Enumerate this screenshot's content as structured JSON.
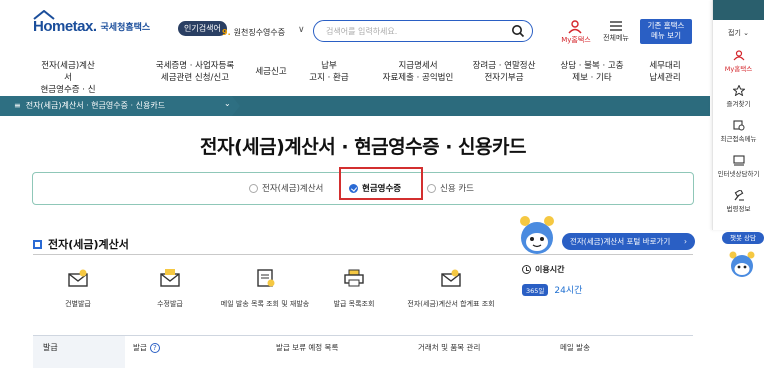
{
  "header": {
    "logo_text": "Hometax.",
    "logo_sub": "국세청홈택스",
    "popular_label": "인기검색어",
    "popular_rank": "9.",
    "popular_term": "원천징수영수증",
    "search_placeholder": "검색어를 입력하세요.",
    "my_label": "My홈택스",
    "all_menu_label": "전체메뉴",
    "prev_hometax_line1": "기존 홈택스",
    "prev_hometax_line2": "메뉴 보기"
  },
  "nav": [
    {
      "l1": "전자(세금)계산서",
      "l2": "현금영수증 · 신용카드"
    },
    {
      "l1": "국세증명 · 사업자등록",
      "l2": "세금관련 신청/신고"
    },
    {
      "l1": "세금신고",
      "l2": ""
    },
    {
      "l1": "납부",
      "l2": "고지 · 환급"
    },
    {
      "l1": "지급명세서",
      "l2": "자료제출 · 공익법인"
    },
    {
      "l1": "장려금 · 연말정산",
      "l2": "전자기부금"
    },
    {
      "l1": "상담 · 불복 · 고충",
      "l2": "제보 · 기타"
    },
    {
      "l1": "세무대리",
      "l2": "납세관리"
    }
  ],
  "breadcrumb": {
    "text": "전자(세금)계산서 · 현금영수증 · 신용카드"
  },
  "page_title": "전자(세금)계산서 · 현금영수증 · 신용카드",
  "tabs": [
    {
      "label": "전자(세금)계산서",
      "active": false
    },
    {
      "label": "현금영수증",
      "active": true
    },
    {
      "label": "신용 카드",
      "active": false
    }
  ],
  "section": {
    "title": "전자(세금)계산서",
    "portal_button": "전자(세금)계산서 포털 바로가기",
    "icons": [
      {
        "label": "건별발급",
        "icon": "envelope-pen-icon"
      },
      {
        "label": "수정발급",
        "icon": "envelope-edit-icon"
      },
      {
        "label": "메일 발송 목록 조회 및 재발송",
        "icon": "document-mail-icon"
      },
      {
        "label": "발급 목록조회",
        "icon": "printer-icon"
      },
      {
        "label": "전자(세금)계산서 합계표 조회",
        "icon": "envelope-search-icon"
      }
    ],
    "hours_title": "이용시간",
    "hours_badge": "365일",
    "hours_value": "24시간"
  },
  "table_row": {
    "header": "발급",
    "cells": [
      "발급",
      "발급 보류 예정 목록",
      "거래처 및 품목 관리",
      "메일 발송"
    ]
  },
  "rail": {
    "fold": "접기",
    "items": [
      {
        "label": "My홈택스",
        "icon": "person-icon"
      },
      {
        "label": "즐겨찾기",
        "icon": "star-icon"
      },
      {
        "label": "최근접속메뉴",
        "icon": "recent-icon"
      },
      {
        "label": "인터넷상담하기",
        "icon": "chat-icon"
      },
      {
        "label": "법령정보",
        "icon": "gavel-icon"
      }
    ],
    "chatbot": "챗봇 상담"
  },
  "colors": {
    "primary": "#2a5fc4",
    "breadcrumb": "#2c6b7d",
    "highlight": "#d32f2f",
    "brand": "#1b4e9b"
  }
}
